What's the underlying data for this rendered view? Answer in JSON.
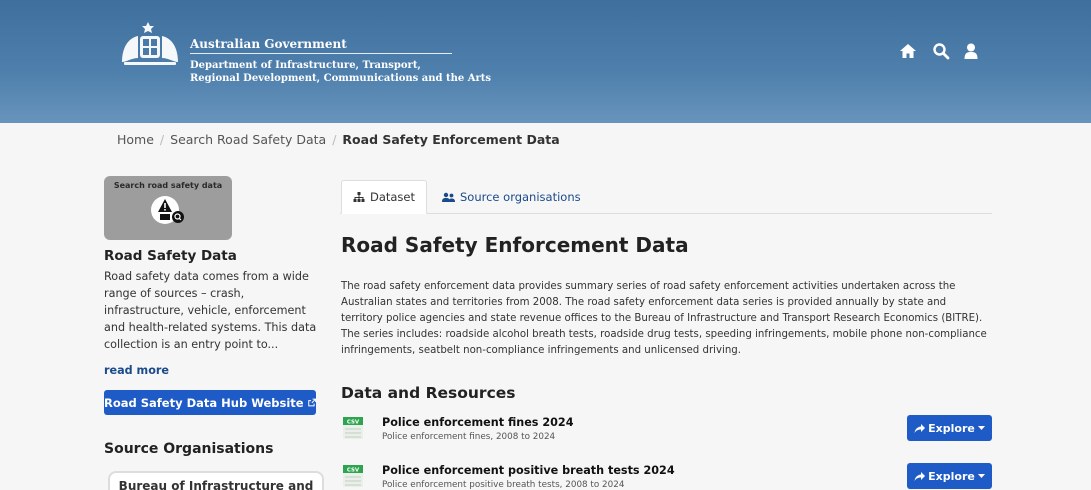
{
  "header": {
    "gov_title": "Australian Government",
    "dept_line1": "Department of Infrastructure, Transport,",
    "dept_line2": "Regional Development, Communications and the Arts",
    "icons": [
      "home-icon",
      "search-icon",
      "user-icon"
    ]
  },
  "breadcrumb": {
    "items": [
      "Home",
      "Search Road Safety Data"
    ],
    "current": "Road Safety Enforcement Data",
    "separator": "/"
  },
  "sidebar": {
    "image_label": "Search road safety data",
    "title": "Road Safety Data",
    "description": "Road safety data comes from a wide range of sources – crash, infrastructure, vehicle, enforcement and health-related systems. This data collection is an entry point to...",
    "read_more": "read more",
    "hub_button": "Road Safety Data Hub Website",
    "orgs_title": "Source Organisations",
    "org_name": "Bureau of Infrastructure and"
  },
  "tabs": {
    "dataset": "Dataset",
    "source_orgs": "Source organisations"
  },
  "main": {
    "title": "Road Safety Enforcement Data",
    "notes": "The road safety enforcement data provides summary series of road safety enforcement activities undertaken across the Australian states and territories from 2008. The road safety enforcement data series is provided annually by state and territory police agencies and state revenue offices to the Bureau of Infrastructure and Transport Research Economics (BITRE). The series includes: roadside alcohol breath tests, roadside drug tests, speeding infringements, mobile phone non-compliance infringements, seatbelt non-compliance infringements and unlicensed driving.",
    "resources_title": "Data and Resources",
    "resources": [
      {
        "name": "Police enforcement fines 2024",
        "description": "Police enforcement fines, 2008 to 2024",
        "format": "CSV",
        "button": "Explore"
      },
      {
        "name": "Police enforcement positive breath tests 2024",
        "description": "Police enforcement positive breath tests, 2008 to 2024",
        "format": "CSV",
        "button": "Explore"
      }
    ]
  },
  "colors": {
    "header_blue": "#4a7aa8",
    "button_blue": "#1f5bc6",
    "link_blue": "#1a4a8a",
    "csv_green": "#2ea44f"
  }
}
